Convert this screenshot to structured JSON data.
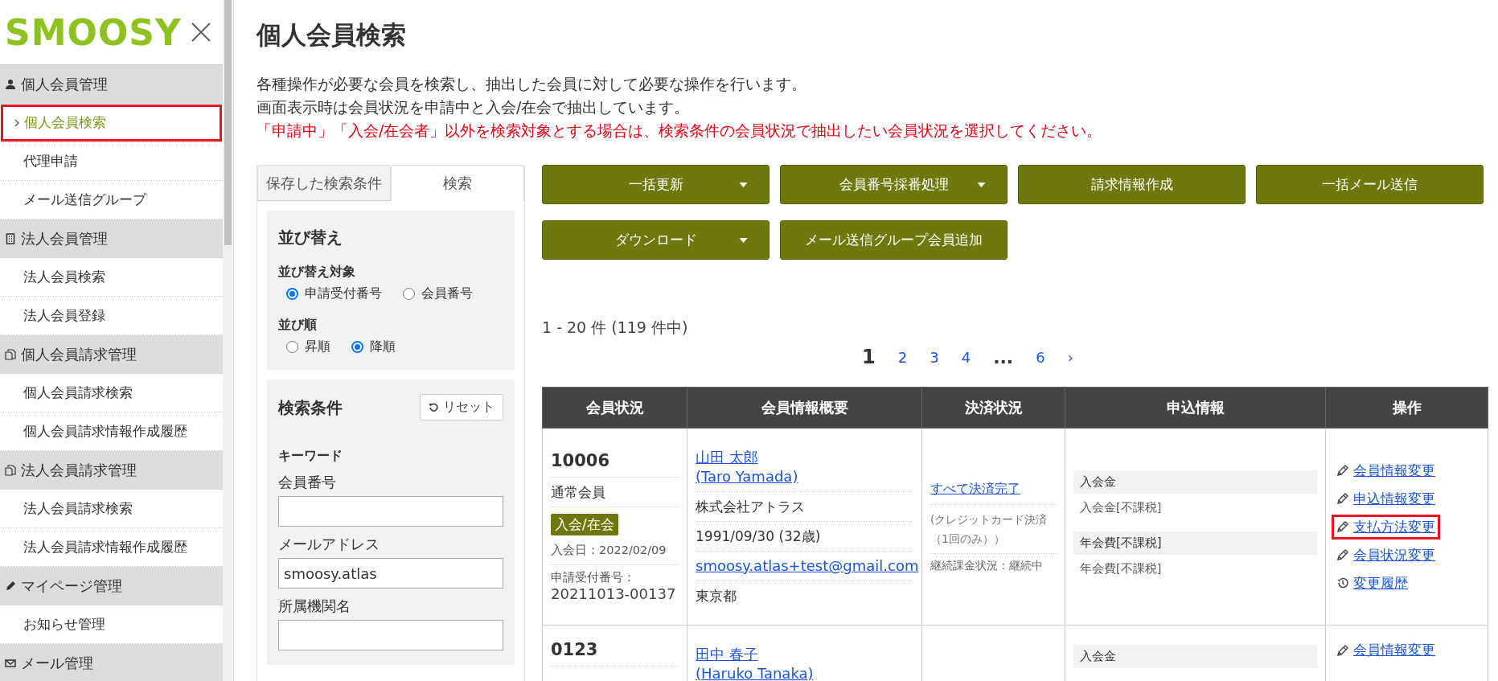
{
  "logo": "SMOOSY",
  "sidebar": {
    "sections": [
      {
        "label": "個人会員管理",
        "kind": "person",
        "items": [
          {
            "label": "個人会員検索",
            "selected": true,
            "highlighted": true
          },
          {
            "label": "代理申請",
            "selected": false,
            "highlighted": false
          },
          {
            "label": "メール送信グループ",
            "selected": false,
            "highlighted": false
          }
        ]
      },
      {
        "label": "法人会員管理",
        "kind": "building",
        "items": [
          {
            "label": "法人会員検索",
            "selected": false,
            "highlighted": false
          },
          {
            "label": "法人会員登録",
            "selected": false,
            "highlighted": false
          }
        ]
      },
      {
        "label": "個人会員請求管理",
        "kind": "document",
        "items": [
          {
            "label": "個人会員請求検索",
            "selected": false,
            "highlighted": false
          },
          {
            "label": "個人会員請求情報作成履歴",
            "selected": false,
            "highlighted": false
          }
        ]
      },
      {
        "label": "法人会員請求管理",
        "kind": "document",
        "items": [
          {
            "label": "法人会員請求検索",
            "selected": false,
            "highlighted": false
          },
          {
            "label": "法人会員請求情報作成履歴",
            "selected": false,
            "highlighted": false
          }
        ]
      },
      {
        "label": "マイページ管理",
        "kind": "pen",
        "items": [
          {
            "label": "お知らせ管理",
            "selected": false,
            "highlighted": false
          }
        ]
      },
      {
        "label": "メール管理",
        "kind": "mail"
      }
    ]
  },
  "page_title": "個人会員検索",
  "description": [
    {
      "text": "各種操作が必要な会員を検索し、抽出した会員に対して必要な操作を行います。",
      "kind": "normal"
    },
    {
      "text": "画面表示時は会員状況を申請中と入会/在会で抽出しています。",
      "kind": "normal"
    },
    {
      "text": "「申請中」「入会/在会者」以外を検索対象とする場合は、検索条件の会員状況で抽出したい会員状況を選択してください。",
      "kind": "warning"
    }
  ],
  "search_panel": {
    "tabs": [
      {
        "label": "保存した検索条件",
        "selected": false
      },
      {
        "label": "検索",
        "selected": true
      }
    ],
    "sort": {
      "title": "並び替え",
      "target_label": "並び替え対象",
      "targets": [
        {
          "label": "申請受付番号",
          "selected": true
        },
        {
          "label": "会員番号",
          "selected": false
        }
      ],
      "order_label": "並び順",
      "orders": [
        {
          "label": "昇順",
          "selected": false
        },
        {
          "label": "降順",
          "selected": true
        }
      ]
    },
    "conditions": {
      "title": "検索条件",
      "reset": "リセット",
      "keyword_label": "キーワード",
      "fields": [
        {
          "label": "会員番号"
        },
        {
          "label": "メールアドレス",
          "value": "smoosy.atlas"
        },
        {
          "label": "所属機関名"
        }
      ]
    }
  },
  "actions": [
    {
      "label": "一括更新",
      "dropdown": true
    },
    {
      "label": "会員番号採番処理",
      "dropdown": true
    },
    {
      "label": "請求情報作成",
      "dropdown": false
    },
    {
      "label": "一括メール送信",
      "dropdown": false
    },
    {
      "label": "ダウンロード",
      "dropdown": true
    },
    {
      "label": "メール送信グループ会員追加",
      "dropdown": false
    }
  ],
  "result_count": "1 - 20 件 (119 件中)",
  "pagination": [
    {
      "label": "1",
      "kind": "current"
    },
    {
      "label": "2",
      "kind": "page"
    },
    {
      "label": "3",
      "kind": "page"
    },
    {
      "label": "4",
      "kind": "page"
    },
    {
      "label": "...",
      "kind": "gap"
    },
    {
      "label": "6",
      "kind": "page"
    },
    {
      "label": "›",
      "kind": "next"
    }
  ],
  "table": {
    "columns": [
      "会員状況",
      "会員情報概要",
      "決済状況",
      "申込情報",
      "操作"
    ],
    "rows": [
      {
        "member_no": "10006",
        "member_type": "通常会員",
        "status_badge": "入会/在会",
        "join_date": "入会日：2022/02/09",
        "application_label": "申請受付番号：",
        "application_no": "20211013-00137",
        "name": "山田 太郎",
        "name_en": "(Taro Yamada)",
        "company": "株式会社アトラス",
        "birth": "1991/09/30 (32歳)",
        "email": "smoosy.atlas+test@gmail.com",
        "prefecture": "東京都",
        "payment_status": "すべて決済完了",
        "payment_method": "(クレジットカード決済（1回のみ））",
        "recurring": "継続課金状況：継続中",
        "fees": [
          {
            "heading": "入会金",
            "item": "入会金[不課税]"
          },
          {
            "heading": "年会費[不課税]",
            "item": "年会費[不課税]"
          }
        ],
        "operations": [
          {
            "label": "会員情報変更",
            "kind": "edit",
            "highlighted": false
          },
          {
            "label": "申込情報変更",
            "kind": "edit",
            "highlighted": false
          },
          {
            "label": "支払方法変更",
            "kind": "edit",
            "highlighted": true
          },
          {
            "label": "会員状況変更",
            "kind": "edit",
            "highlighted": false
          },
          {
            "label": "変更履歴",
            "kind": "history",
            "highlighted": false
          }
        ]
      },
      {
        "member_no": "0123",
        "name": "田中 春子",
        "name_en": "(Haruko Tanaka)",
        "fees": [
          {
            "heading": "入会金"
          }
        ],
        "operations": [
          {
            "label": "会員情報変更",
            "kind": "edit",
            "highlighted": false
          }
        ]
      }
    ]
  }
}
